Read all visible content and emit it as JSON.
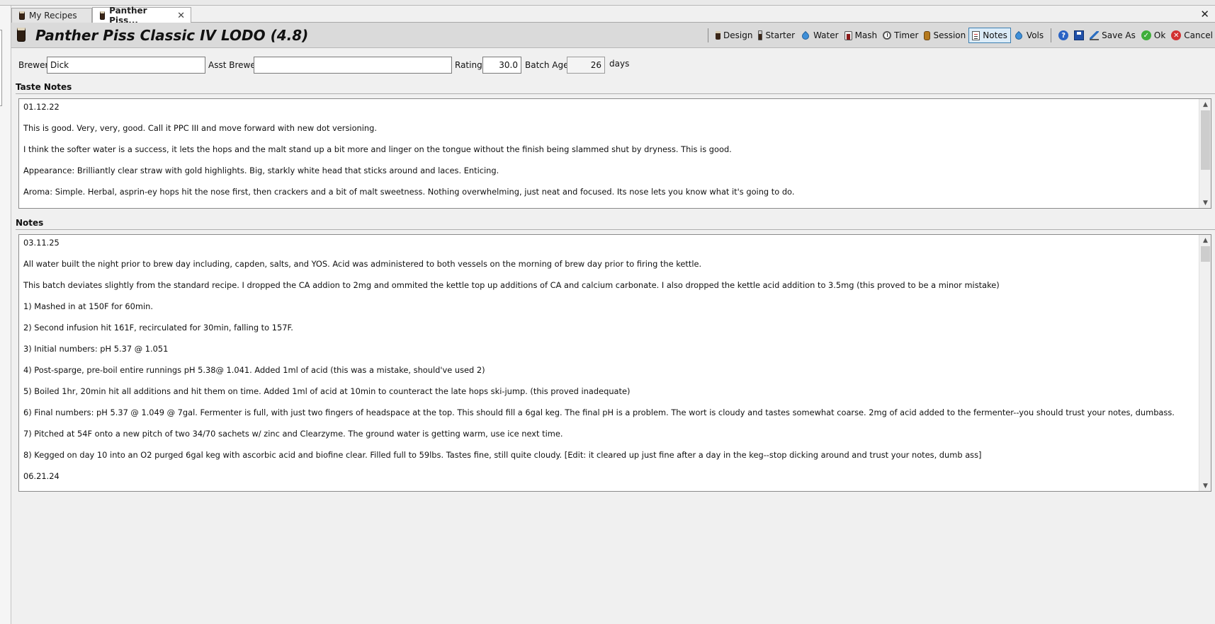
{
  "tabs": [
    {
      "label": "My Recipes",
      "active": false
    },
    {
      "label": "Panther Piss...",
      "active": true
    }
  ],
  "header": {
    "title": "Panther Piss Classic IV LODO (4.8)"
  },
  "toolbar": {
    "design": "Design",
    "starter": "Starter",
    "water": "Water",
    "mash": "Mash",
    "timer": "Timer",
    "session": "Session",
    "notes": "Notes",
    "vols": "Vols",
    "save_as": "Save As",
    "ok": "Ok",
    "cancel": "Cancel",
    "active_item": "Notes"
  },
  "fields": {
    "brewer_label": "Brewer",
    "brewer_value": "Dick",
    "asst_brewer_label": "Asst Brewer",
    "asst_brewer_value": "",
    "rating_label": "Rating",
    "rating_value": "30.0",
    "batch_age_label": "Batch Age",
    "batch_age_value": "26",
    "batch_age_unit": "days"
  },
  "taste_notes": {
    "heading": "Taste Notes",
    "lines": [
      "01.12.22",
      "This is good. Very, very, good. Call it PPC III and move forward with new dot versioning.",
      "I think the softer water is a success, it lets the hops and the malt stand up a bit more and linger on the tongue without the finish being slammed shut by dryness. This is good.",
      "Appearance: Brilliantly clear straw with gold highlights. Big, starkly white head that sticks around and laces. Enticing.",
      "Aroma: Simple. Herbal, asprin-ey hops hit the nose first, then crackers and a bit of malt sweetness. Nothing overwhelming, just neat and focused. Its nose lets you know what it's going to do."
    ]
  },
  "notes": {
    "heading": "Notes",
    "lines": [
      "03.11.25",
      "All water built the night prior to brew day including, capden, salts, and YOS. Acid was administered to both vessels on the morning of brew day prior to firing the kettle.",
      "This batch deviates slightly from the standard recipe. I dropped the CA addion to 2mg and ommited the kettle top up additions of CA and calcium carbonate. I also dropped the kettle acid addition to 3.5mg (this proved to be a minor mistake)",
      "1) Mashed in at 150F for 60min.",
      "2) Second infusion hit 161F, recirculated for 30min, falling to 157F.",
      "3) Initial numbers: pH 5.37 @ 1.051",
      "4) Post-sparge, pre-boil entire runnings pH 5.38@ 1.041. Added 1ml of acid (this was a mistake, should've used 2)",
      "5) Boiled 1hr, 20min hit all additions and hit them on time. Added 1ml of acid at 10min to counteract the late hops ski-jump. (this proved inadequate)",
      "6) Final numbers: pH 5.37 @ 1.049 @ 7gal. Fermenter is full, with just two fingers of headspace at the top. This should fill a 6gal keg. The final pH is a problem. The wort is cloudy and tastes somewhat coarse. 2mg of acid added to the fermenter--you should trust your notes, dumbass.",
      "7) Pitched at 54F onto a new pitch of two 34/70 sachets w/ zinc and Clearzyme. The ground water is getting warm, use ice next time.",
      "8) Kegged on day 10 into an O2 purged 6gal keg with ascorbic acid and biofine clear. Filled full to 59lbs. Tastes fine, still quite cloudy. [Edit: it cleared up just fine after a day in the keg--stop dicking around and trust your notes, dumb ass]",
      "06.21.24"
    ]
  },
  "icons": {
    "recipe": "beer-mug-icon",
    "design": "beer-mug-icon",
    "starter": "flask-icon",
    "water": "water-drop-icon",
    "mash": "mash-tun-icon",
    "timer": "stopwatch-icon",
    "session": "keg-icon",
    "notes": "notepad-icon",
    "vols": "water-drop-icon",
    "help": "help-icon",
    "save": "floppy-disk-icon",
    "save_as": "pencil-icon",
    "ok": "check-icon",
    "cancel": "cancel-icon"
  },
  "colors": {
    "active_toolbar_border": "#3c7fb1",
    "active_toolbar_bg": "#dcecf8",
    "header_bg": "#dadada",
    "ok_green": "#3fae3a",
    "cancel_red": "#d23232"
  }
}
